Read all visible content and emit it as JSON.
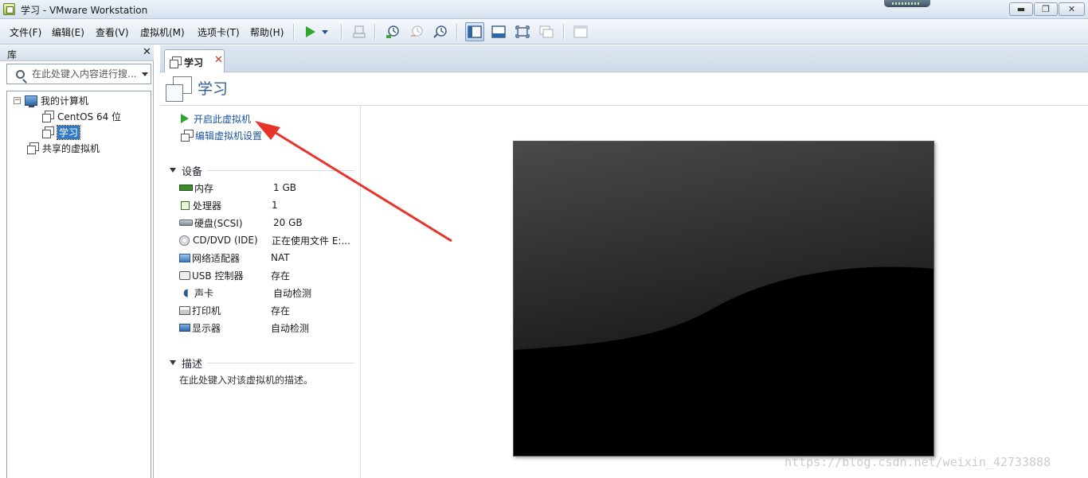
{
  "window": {
    "title": "学习 - VMware Workstation",
    "buttons": {
      "minimize": "▬",
      "maximize": "❐",
      "close": "✕"
    }
  },
  "menubar": {
    "items": [
      "文件(F)",
      "编辑(E)",
      "查看(V)",
      "虚拟机(M)",
      "选项卡(T)",
      "帮助(H)"
    ]
  },
  "toolbar": {
    "icons": [
      "power-on-icon",
      "power-dropdown-icon",
      "send-ctrl-alt-del-icon",
      "snapshot-take-icon",
      "snapshot-revert-icon",
      "snapshot-manager-icon",
      "show-library-icon",
      "show-thumbnail-icon",
      "fullscreen-icon",
      "unity-icon",
      "console-view-icon"
    ],
    "accent": "#2ea52c"
  },
  "library": {
    "title": "库",
    "close": "✕",
    "search_placeholder": "在此处键入内容进行搜...",
    "tree": {
      "root": {
        "label": "我的计算机",
        "expander": "−"
      },
      "vms": [
        "CentOS 64 位",
        "学习"
      ],
      "selected": "学习",
      "shared": "共享的虚拟机"
    }
  },
  "tab": {
    "label": "学习",
    "close": "✕"
  },
  "vm": {
    "title": "学习",
    "actions": {
      "power_on": "开启此虚拟机",
      "edit_settings": "编辑虚拟机设置"
    },
    "devices_section": "设备",
    "devices": [
      {
        "name": "内存",
        "value": "1 GB",
        "icon": "memory-icon"
      },
      {
        "name": "处理器",
        "value": "1",
        "icon": "processor-icon"
      },
      {
        "name": "硬盘(SCSI)",
        "value": "20 GB",
        "icon": "hard-disk-icon"
      },
      {
        "name": "CD/DVD (IDE)",
        "value": "正在使用文件 E:...",
        "icon": "cd-dvd-icon"
      },
      {
        "name": "网络适配器",
        "value": "NAT",
        "icon": "network-adapter-icon"
      },
      {
        "name": "USB 控制器",
        "value": "存在",
        "icon": "usb-controller-icon"
      },
      {
        "name": "声卡",
        "value": "自动检测",
        "icon": "sound-card-icon"
      },
      {
        "name": "打印机",
        "value": "存在",
        "icon": "printer-icon"
      },
      {
        "name": "显示器",
        "value": "自动检测",
        "icon": "display-icon"
      }
    ],
    "description_section": "描述",
    "description_placeholder": "在此处键入对该虚拟机的描述。"
  },
  "colors": {
    "title_blue": "#2f5d97",
    "link_blue": "#1a55a3",
    "annotation_red": "#e8332a",
    "selection": "#3279c6"
  },
  "watermark": "https://blog.csdn.net/weixin_42733888"
}
